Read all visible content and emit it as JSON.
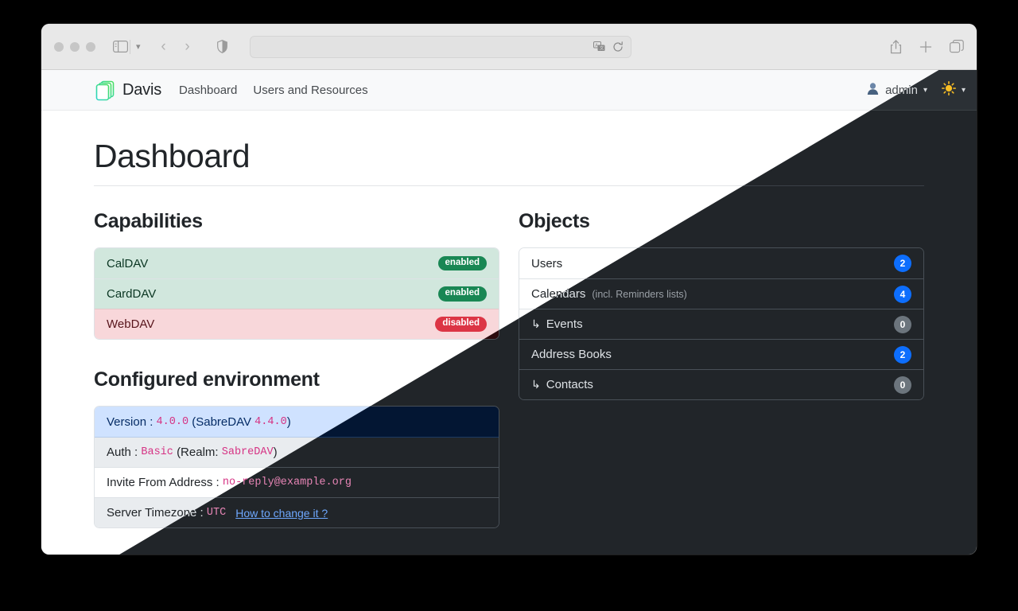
{
  "browser": {
    "address_bar_value": "",
    "address_bar_placeholder": "",
    "icons": {
      "sidebar": "sidebar-icon",
      "sidebar_chevron": "chevron-down-icon",
      "back": "back-arrow-icon",
      "forward": "forward-arrow-icon",
      "shield": "privacy-shield-icon",
      "translate": "translate-icon",
      "reload": "reload-icon",
      "share": "share-icon",
      "new_tab": "plus-icon",
      "tab_overview": "tab-overview-icon"
    }
  },
  "navbar": {
    "brand": "Davis",
    "links": [
      {
        "label": "Dashboard"
      },
      {
        "label": "Users and Resources"
      }
    ],
    "user": "admin",
    "user_icon": "user-bust-icon",
    "theme_icon": "sun-icon",
    "caret": "▾"
  },
  "page": {
    "title": "Dashboard"
  },
  "capabilities": {
    "title": "Capabilities",
    "items": [
      {
        "label": "CalDAV",
        "status": "enabled",
        "state": "success"
      },
      {
        "label": "CardDAV",
        "status": "enabled",
        "state": "success"
      },
      {
        "label": "WebDAV",
        "status": "disabled",
        "state": "danger"
      }
    ]
  },
  "environment": {
    "title": "Configured environment",
    "rows": [
      {
        "label": "Version :",
        "value": "4.0.0",
        "suffix_pre": "(SabreDAV",
        "suffix_value": "4.4.0",
        "suffix_post": ")",
        "style": "info"
      },
      {
        "label": "Auth :",
        "value": "Basic",
        "suffix_pre": "(Realm:",
        "suffix_value": "SabreDAV",
        "suffix_post": ")",
        "style": "muted"
      },
      {
        "label": "Invite From Address :",
        "value": "no-reply@example.org",
        "style": "plain"
      },
      {
        "label": "Server Timezone :",
        "value": "UTC",
        "link": "How to change it ?",
        "style": "muted"
      }
    ]
  },
  "objects": {
    "title": "Objects",
    "items": [
      {
        "label": "Users",
        "note": "",
        "count": "2",
        "badge": "primary",
        "sub": false
      },
      {
        "label": "Calendars",
        "note": "(incl. Reminders lists)",
        "count": "4",
        "badge": "primary",
        "sub": false
      },
      {
        "label": "Events",
        "note": "",
        "count": "0",
        "badge": "secondary",
        "sub": true
      },
      {
        "label": "Address Books",
        "note": "",
        "count": "2",
        "badge": "primary",
        "sub": false
      },
      {
        "label": "Contacts",
        "note": "",
        "count": "0",
        "badge": "secondary",
        "sub": true
      }
    ],
    "sub_arrow": "↳"
  },
  "colors": {
    "accent_blue": "#0d6efd",
    "success_green": "#198754",
    "danger_red": "#dc3545",
    "secondary_gray": "#6c757d",
    "code_pink": "#d63384",
    "dark_bg": "#212529",
    "dark_navbar": "#2b3035",
    "light_navbar": "#f8f9fa"
  }
}
